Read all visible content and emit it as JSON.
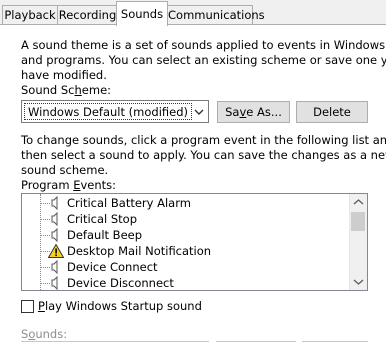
{
  "tabs": [
    {
      "label": "Playback"
    },
    {
      "label": "Recording"
    },
    {
      "label": "Sounds"
    },
    {
      "label": "Communications"
    }
  ],
  "intro": {
    "line1": "A sound theme is a set of sounds applied to events in Windows",
    "line2": "and programs.  You can select an existing scheme or save one you",
    "line3": "have modified."
  },
  "scheme": {
    "label_pre": "Sound Sc",
    "label_key": "h",
    "label_post": "eme:",
    "selected": "Windows Default (modified)",
    "save_pre": "Sa",
    "save_key": "v",
    "save_post": "e As...",
    "delete_label": "Delete"
  },
  "instructions": {
    "line1": "To change sounds, click a program event in the following list and",
    "line2": "then select a sound to apply.  You can save the changes as a new",
    "line3": "sound scheme."
  },
  "events": {
    "label_pre": "Program ",
    "label_key": "E",
    "label_post": "vents:",
    "items": [
      {
        "label": "Critical Battery Alarm",
        "icon": "speaker-icon"
      },
      {
        "label": "Critical Stop",
        "icon": "speaker-icon"
      },
      {
        "label": "Default Beep",
        "icon": "speaker-icon"
      },
      {
        "label": "Desktop Mail Notification",
        "icon": "warning-icon"
      },
      {
        "label": "Device Connect",
        "icon": "speaker-icon"
      },
      {
        "label": "Device Disconnect",
        "icon": "speaker-icon"
      }
    ]
  },
  "startup": {
    "key": "P",
    "label_post": "lay Windows Startup sound",
    "checked": false
  },
  "sounds": {
    "label_pre": "S",
    "label_key": "o",
    "label_post": "unds:"
  }
}
